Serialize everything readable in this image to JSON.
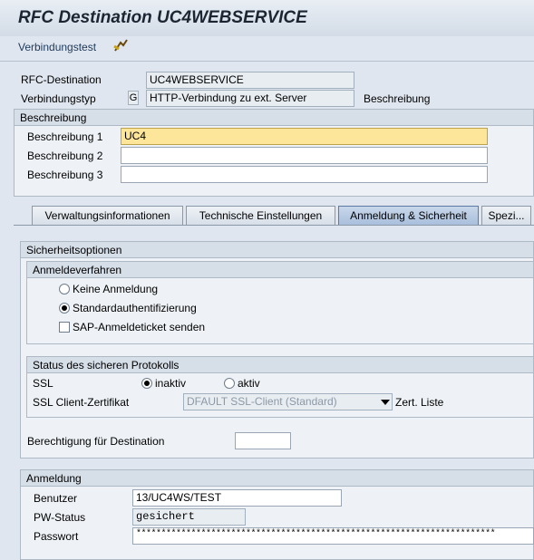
{
  "window": {
    "title": "RFC Destination UC4WEBSERVICE"
  },
  "toolbar": {
    "connection_test": "Verbindungstest",
    "icon": "connection-test-icon"
  },
  "header": {
    "rfc_destination_label": "RFC-Destination",
    "rfc_destination_value": "UC4WEBSERVICE",
    "connection_type_label": "Verbindungstyp",
    "connection_type_code": "G",
    "connection_type_value": "HTTP-Verbindung zu ext. Server",
    "description_label": "Beschreibung"
  },
  "description": {
    "group_title": "Beschreibung",
    "label1": "Beschreibung 1",
    "value1": "UC4",
    "label2": "Beschreibung 2",
    "value2": "",
    "label3": "Beschreibung 3",
    "value3": ""
  },
  "tabs": [
    {
      "label": "Verwaltungsinformationen"
    },
    {
      "label": "Technische Einstellungen"
    },
    {
      "label": "Anmeldung & Sicherheit"
    },
    {
      "label": "Spezi..."
    }
  ],
  "security": {
    "group_title": "Sicherheitsoptionen",
    "logon_procedure": {
      "title": "Anmeldeverfahren",
      "no_logon": "Keine Anmeldung",
      "standard_auth": "Standardauthentifizierung",
      "sap_ticket": "SAP-Anmeldeticket senden"
    },
    "protocol": {
      "title": "Status des sicheren Protokolls",
      "ssl_label": "SSL",
      "inactive": "inaktiv",
      "active": "aktiv",
      "cert_label": "SSL Client-Zertifikat",
      "cert_value": "DFAULT SSL-Client (Standard)",
      "cert_list": "Zert. Liste"
    },
    "authorization_label": "Berechtigung für Destination",
    "authorization_value": ""
  },
  "logon": {
    "group_title": "Anmeldung",
    "user_label": "Benutzer",
    "user_value": "13/UC4WS/TEST",
    "pw_status_label": "PW-Status",
    "pw_status_value": "gesichert",
    "password_label": "Passwort",
    "password_value": "************************************************************************"
  },
  "colors": {
    "accent": "#fde59a",
    "active_tab": "#a9bfdc",
    "background": "#dfe6ef"
  }
}
